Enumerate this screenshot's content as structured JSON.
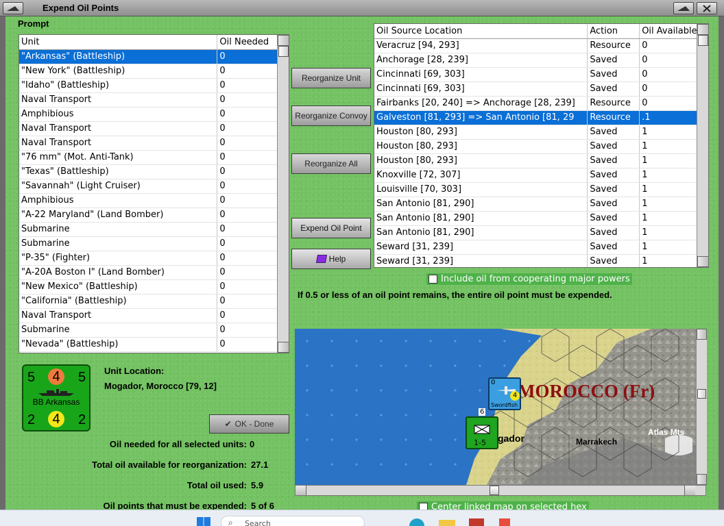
{
  "window": {
    "title": "Expend Oil Points"
  },
  "prompt_label": "Prompt",
  "units_table": {
    "headers": [
      "Unit",
      "Oil Needed"
    ],
    "rows": [
      [
        "\"Arkansas\" (Battleship)",
        "0"
      ],
      [
        "\"New York\" (Battleship)",
        "0"
      ],
      [
        "\"Idaho\" (Battleship)",
        "0"
      ],
      [
        "Naval Transport",
        "0"
      ],
      [
        "Amphibious",
        "0"
      ],
      [
        "Naval Transport",
        "0"
      ],
      [
        "Naval Transport",
        "0"
      ],
      [
        "\"76 mm\" (Mot. Anti-Tank)",
        "0"
      ],
      [
        "\"Texas\" (Battleship)",
        "0"
      ],
      [
        "\"Savannah\" (Light Cruiser)",
        "0"
      ],
      [
        "Amphibious",
        "0"
      ],
      [
        "\"A-22 Maryland\" (Land Bomber)",
        "0"
      ],
      [
        "Submarine",
        "0"
      ],
      [
        "Submarine",
        "0"
      ],
      [
        "\"P-35\" (Fighter)",
        "0"
      ],
      [
        "\"A-20A Boston I\" (Land Bomber)",
        "0"
      ],
      [
        "\"New Mexico\" (Battleship)",
        "0"
      ],
      [
        "\"California\" (Battleship)",
        "0"
      ],
      [
        "Naval Transport",
        "0"
      ],
      [
        "Submarine",
        "0"
      ],
      [
        "\"Nevada\" (Battleship)",
        "0"
      ]
    ],
    "selected_index": 0
  },
  "buttons": {
    "reorganize_unit": "Reorganize Unit",
    "reorganize_convoy": "Reorganize Convoy",
    "reorganize_all": "Reorganize All",
    "expend_oil_point": "Expend Oil Point",
    "help": "Help",
    "ok_done": "OK - Done"
  },
  "sources_table": {
    "headers": [
      "Oil Source Location",
      "Action",
      "Oil Available"
    ],
    "rows": [
      [
        "Veracruz [94, 293]",
        "Resource",
        "0"
      ],
      [
        "Anchorage [28, 239]",
        "Saved",
        "0"
      ],
      [
        "Cincinnati [69, 303]",
        "Saved",
        "0"
      ],
      [
        "Cincinnati [69, 303]",
        "Saved",
        "0"
      ],
      [
        "Fairbanks [20, 240] => Anchorage [28, 239]",
        "Resource",
        "0"
      ],
      [
        "Galveston [81, 293] => San Antonio [81, 29",
        "Resource",
        ".1"
      ],
      [
        "Houston [80, 293]",
        "Saved",
        "1"
      ],
      [
        "Houston [80, 293]",
        "Saved",
        "1"
      ],
      [
        "Houston [80, 293]",
        "Saved",
        "1"
      ],
      [
        "Knoxville [72, 307]",
        "Saved",
        "1"
      ],
      [
        "Louisville [70, 303]",
        "Saved",
        "1"
      ],
      [
        "San Antonio [81, 290]",
        "Saved",
        "1"
      ],
      [
        "San Antonio [81, 290]",
        "Saved",
        "1"
      ],
      [
        "San Antonio [81, 290]",
        "Saved",
        "1"
      ],
      [
        "Seward [31, 239]",
        "Saved",
        "1"
      ],
      [
        "Seward [31, 239]",
        "Saved",
        "1"
      ]
    ],
    "selected_index": 5
  },
  "include_cooperating": {
    "label": "Include oil from cooperating major powers",
    "checked": false
  },
  "rule_note": "If 0.5 or less of an oil point remains, the entire oil point must be expended.",
  "unit_counter": {
    "top_left": "5",
    "top_mid": "4",
    "top_right": "5",
    "name": "BB Arkansas",
    "bottom_left": "2",
    "bottom_mid": "4",
    "bottom_right": "2",
    "colors": {
      "bg": "#19a519",
      "top_mid": "#f07a3c",
      "bottom_mid": "#f3e61a"
    }
  },
  "unit_location": {
    "label": "Unit Location:",
    "value": "Mogador, Morocco [79, 12]"
  },
  "stats": [
    {
      "label": "Oil needed for all selected units:",
      "value": "0"
    },
    {
      "label": "Total oil available for reorganization:",
      "value": "27.1"
    },
    {
      "label": "Total oil used:",
      "value": "5.9"
    },
    {
      "label": "Oil points that must be expended:",
      "value": "5 of 6"
    }
  ],
  "map": {
    "region_label": "MOROCCO (Fr)",
    "cities": [
      "Marrakech",
      "gador",
      "Atlas Mts"
    ],
    "unit_a": {
      "strength": "0",
      "name": "Swordfish",
      "value": "4",
      "color": "#3b9ee0"
    },
    "unit_b": {
      "stack": "6",
      "stat": "1-5",
      "color": "#1fa51f"
    }
  },
  "center_map": {
    "label": "Center linked map on selected hex",
    "checked": false
  },
  "taskbar": {
    "search_placeholder": "Search"
  }
}
